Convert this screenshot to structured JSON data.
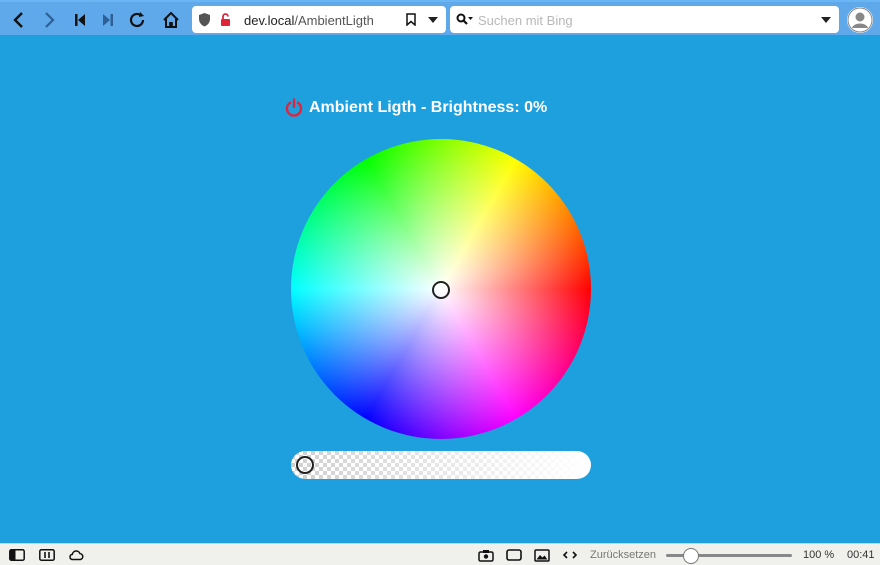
{
  "toolbar": {
    "url_host": "dev.local",
    "url_path": "/AmbientLigth",
    "search_placeholder": "Suchen mit Bing"
  },
  "main": {
    "title": "Ambient Ligth - Brightness: 0%",
    "brightness_percent": 0
  },
  "statusbar": {
    "reset_label": "Zurücksetzen",
    "zoom": "100 %",
    "time": "00:41"
  },
  "colors": {
    "page_background": "#1ea0df",
    "toolbar_background": "#5fa8ea",
    "power_icon": "#e0243a"
  }
}
